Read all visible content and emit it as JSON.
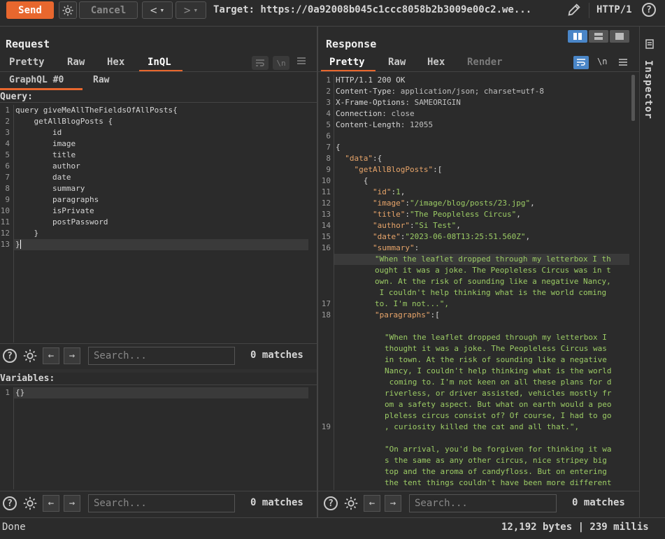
{
  "toolbar": {
    "send_label": "Send",
    "cancel_label": "Cancel",
    "back_label": "<",
    "forward_label": ">",
    "dropdown_glyph": "▾",
    "target": "Target: https://0a92008b045c1ccc8058b2b3009e00c2.we...",
    "http_version": "HTTP/1",
    "help_glyph": "?"
  },
  "request": {
    "title": "Request",
    "tabs": [
      "Pretty",
      "Raw",
      "Hex",
      "InQL"
    ],
    "active_tab": "InQL",
    "subtabs": [
      "GraphQL #0",
      "Raw"
    ],
    "query_label": "Query:",
    "query_lines": [
      "query giveMeAllTheFieldsOfAllPosts{",
      "    getAllBlogPosts {",
      "        id",
      "        image",
      "        title",
      "        author",
      "        date",
      "        summary",
      "        paragraphs",
      "        isPrivate",
      "        postPassword",
      "    }",
      "}"
    ],
    "query_line_numbers": "1\n2\n3\n4\n5\n6\n7\n8\n9\n10\n11\n12\n13",
    "variables_label": "Variables:",
    "variables_line_number": "1",
    "variables_value": "{}",
    "search_placeholder": "Search...",
    "matches": "0 matches"
  },
  "response": {
    "title": "Response",
    "tabs": [
      "Pretty",
      "Raw",
      "Hex",
      "Render"
    ],
    "active_tab": "Pretty",
    "headers": [
      {
        "k": "HTTP/1.1 200 OK",
        "v": ""
      },
      {
        "k": "Content-Type",
        "v": ": application/json; charset=utf-8"
      },
      {
        "k": "X-Frame-Options",
        "v": ": SAMEORIGIN"
      },
      {
        "k": "Connection",
        "v": ": close"
      },
      {
        "k": "Content-Length",
        "v": ": 12055"
      }
    ],
    "line_numbers": "1\n2\n3\n4\n5\n6\n7\n8\n9\n10\n11\n12\n13\n14\n15\n16\n\n\n\n\n17\n18\n\n\n\n\n\n\n\n\n\n19",
    "json_fields": {
      "data": "\"data\"",
      "getAllBlogPosts": "\"getAllBlogPosts\"",
      "id_key": "\"id\"",
      "id_val": "1",
      "image_key": "\"image\"",
      "image_val": "\"/image/blog/posts/23.jpg\"",
      "title_key": "\"title\"",
      "title_val": "\"The Peopleless Circus\"",
      "author_key": "\"author\"",
      "author_val": "\"Si Test\"",
      "date_key": "\"date\"",
      "date_val": "\"2023-06-08T13:25:51.560Z\"",
      "summary_key": "\"summary\"",
      "summary_val": "\"When the leaflet dropped through my letterbox I th\nought it was a joke. The Peopleless Circus was in t\nown. At the risk of sounding like a negative Nancy,\n I couldn't help thinking what is the world coming\nto. I'm not...\",",
      "paragraphs_key": "\"paragraphs\"",
      "para1": "\"When the leaflet dropped through my letterbox I\nthought it was a joke. The Peopleless Circus was\nin town. At the risk of sounding like a negative\nNancy, I couldn't help thinking what is the world\n coming to. I'm not keen on all these plans for d\nriverless, or driver assisted, vehicles mostly fr\nom a safety aspect. But what on earth would a peo\npleless circus consist of? Of course, I had to go\n, curiosity killed the cat and all that.\",",
      "para2": "\"On arrival, you'd be forgiven for thinking it wa\ns the same as any other circus, nice stripey big\ntop and the aroma of candyfloss. But on entering\nthe tent things couldn't have been more different"
    },
    "wrap_glyph": "\\n",
    "search_placeholder": "Search...",
    "matches": "0 matches"
  },
  "inspector": {
    "label": "Inspector"
  },
  "statusbar": {
    "left": "Done",
    "right": "12,192 bytes | 239 millis"
  },
  "colors": {
    "accent": "#e8672e",
    "blue": "#4a86c8",
    "key": "#e8a56a",
    "string": "#9ccc65"
  }
}
